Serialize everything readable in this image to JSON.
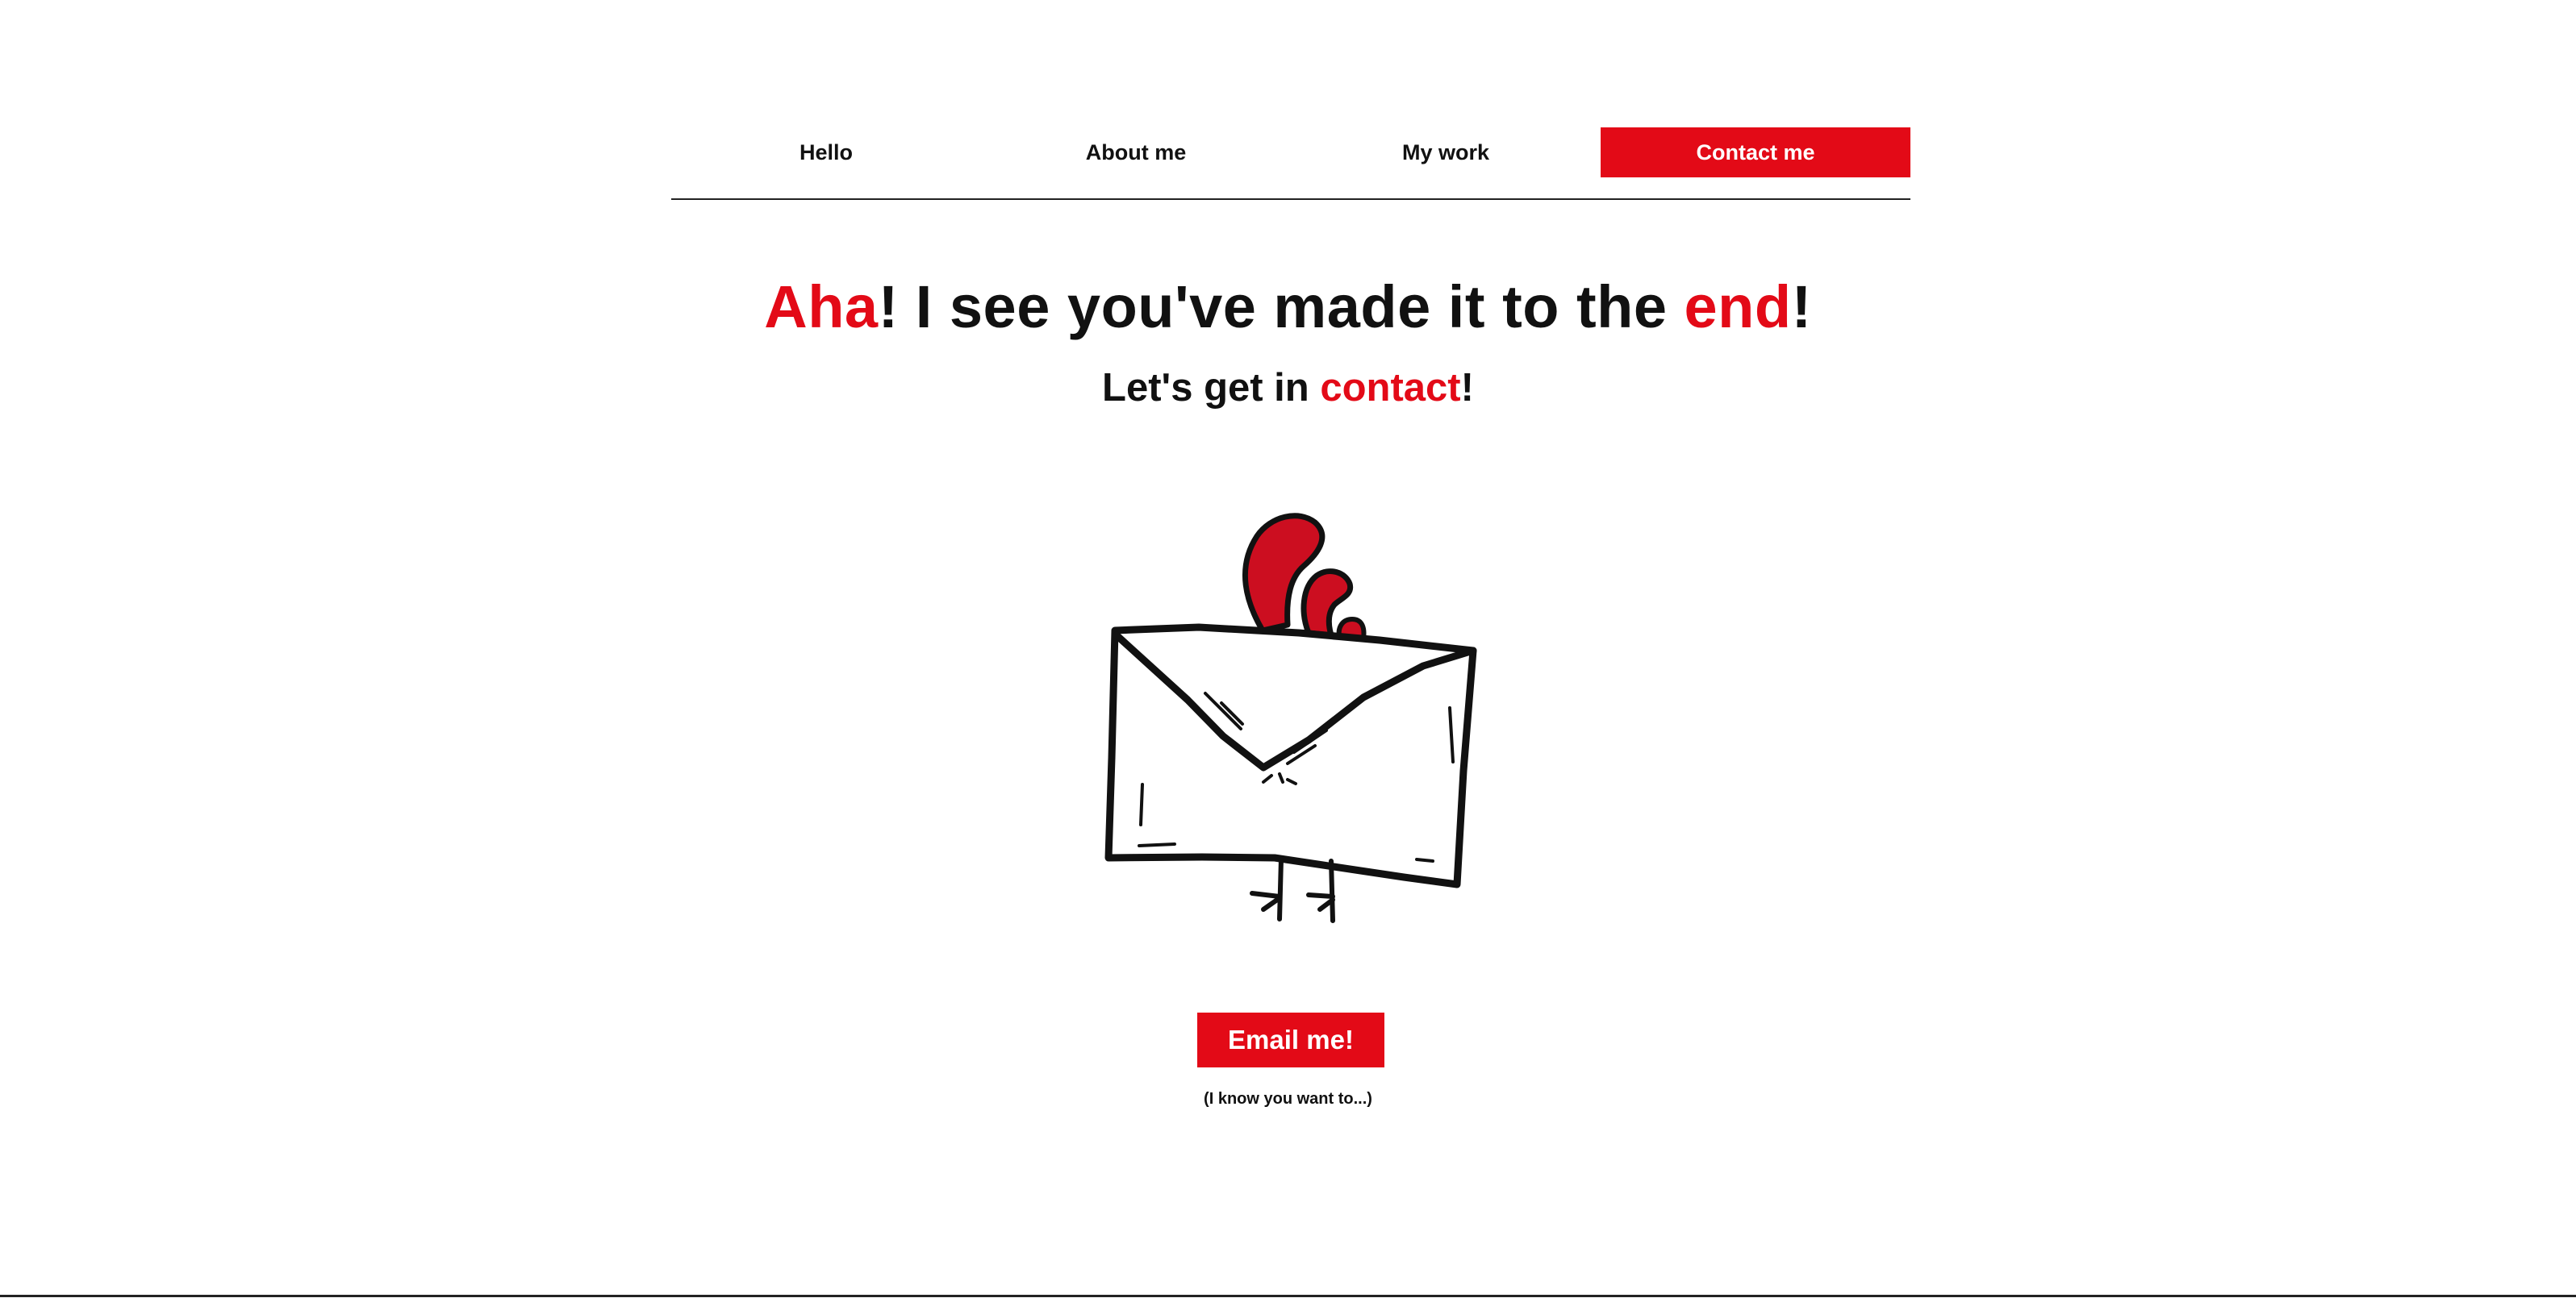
{
  "nav": {
    "items": [
      {
        "label": "Hello",
        "active": false
      },
      {
        "label": "About me",
        "active": false
      },
      {
        "label": "My work",
        "active": false
      },
      {
        "label": "Contact me",
        "active": true
      }
    ]
  },
  "hero": {
    "title_part1": "Aha",
    "title_part2": "! I see you've made it to the ",
    "title_part3": "end",
    "title_part4": "!",
    "subtitle_part1": "Let's get in ",
    "subtitle_part2": "contact",
    "subtitle_part3": "!"
  },
  "illustration": {
    "icon": "envelope-bird-illustration"
  },
  "cta": {
    "label": "Email me!",
    "note": "(I know you want to...)"
  },
  "colors": {
    "accent": "#e30a17",
    "text": "#111111",
    "background": "#ffffff"
  }
}
